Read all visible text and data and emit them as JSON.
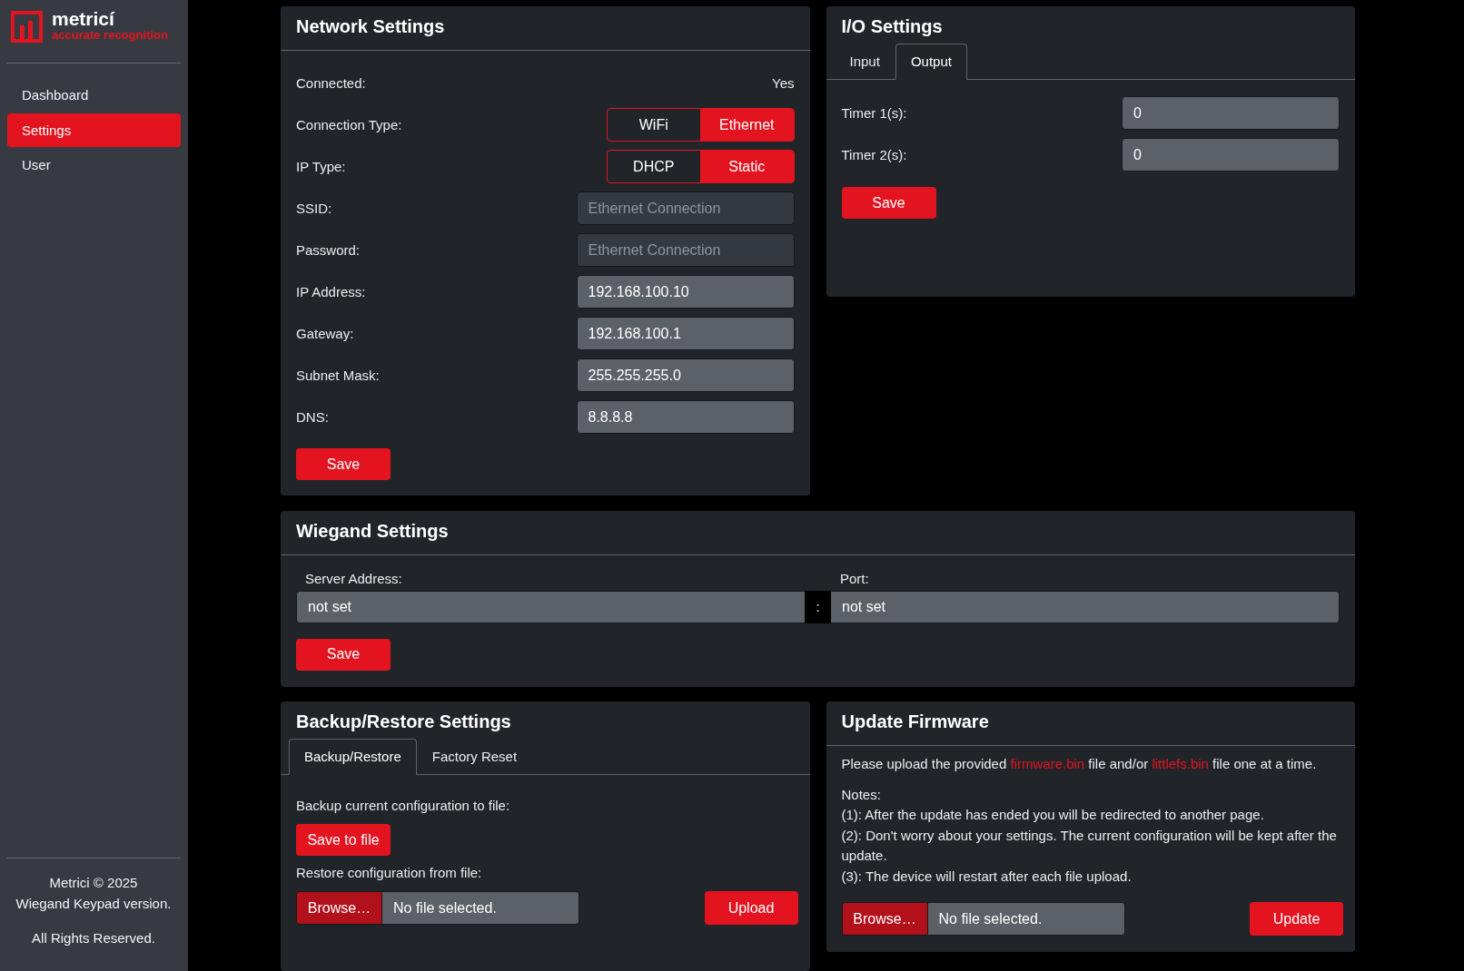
{
  "sidebar": {
    "logo": {
      "wordmark": "metricí",
      "tagline": "accurate recognition"
    },
    "nav": [
      {
        "label": "Dashboard",
        "selected": false
      },
      {
        "label": "Settings",
        "selected": true
      },
      {
        "label": "User",
        "selected": false
      }
    ],
    "footer": {
      "lines": [
        "Metrici © 2025",
        "Wiegand Keypad version."
      ],
      "rights": "All Rights Reserved."
    }
  },
  "network_settings": {
    "title": "Network Settings",
    "fields": [
      {
        "kind": "value",
        "label": "Connected:",
        "value": "Yes"
      },
      {
        "kind": "toggle",
        "label": "Connection Type:",
        "options": [
          {
            "label": "WiFi",
            "selected": false
          },
          {
            "label": "Ethernet",
            "selected": true
          }
        ]
      },
      {
        "kind": "toggle",
        "label": "IP Type:",
        "options": [
          {
            "label": "DHCP",
            "selected": false
          },
          {
            "label": "Static",
            "selected": true
          }
        ]
      },
      {
        "kind": "input",
        "label": "SSID:",
        "placeholder": "Ethernet Connection",
        "disabled": true
      },
      {
        "kind": "input",
        "label": "Password:",
        "placeholder": "Ethernet Connection",
        "disabled": true
      },
      {
        "kind": "input",
        "label": "IP Address:",
        "value": "192.168.100.10",
        "disabled": false
      },
      {
        "kind": "input",
        "label": "Gateway:",
        "value": "192.168.100.1",
        "disabled": false
      },
      {
        "kind": "input",
        "label": "Subnet Mask:",
        "value": "255.255.255.0",
        "disabled": false
      },
      {
        "kind": "input",
        "label": "DNS:",
        "value": "8.8.8.8",
        "disabled": false
      }
    ],
    "save_button": "Save"
  },
  "io_settings": {
    "title": "I/O Settings",
    "tabs": [
      {
        "label": "Input",
        "selected": false
      },
      {
        "label": "Output",
        "selected": true
      }
    ],
    "fields": [
      {
        "label": "Timer 1(s):",
        "value": "0"
      },
      {
        "label": "Timer 2(s):",
        "value": "0"
      }
    ],
    "save_button": "Save"
  },
  "wiegand_settings": {
    "title": "Wiegand Settings",
    "server_address": {
      "label": "Server Address:",
      "value": "not set"
    },
    "separator": ":",
    "port": {
      "label": "Port:",
      "value": "not set"
    },
    "save_button": "Save"
  },
  "backup_restore": {
    "title": "Backup/Restore Settings",
    "tabs": [
      {
        "label": "Backup/Restore",
        "selected": true
      },
      {
        "label": "Factory Reset",
        "selected": false
      }
    ],
    "backup_label": "Backup current configuration to file:",
    "save_to_file_button": "Save to file",
    "restore_label": "Restore configuration from file:",
    "file_input": {
      "button": "Browse…",
      "status": "No file selected."
    },
    "upload_button": "Upload"
  },
  "update_firmware": {
    "title": "Update Firmware",
    "instructions": [
      {
        "kind": "text",
        "text": "Please upload the provided "
      },
      {
        "kind": "link",
        "text": "firmware.bin"
      },
      {
        "kind": "text",
        "text": " file and/or "
      },
      {
        "kind": "link",
        "text": "littlefs.bin"
      },
      {
        "kind": "text",
        "text": " file one at a time."
      }
    ],
    "notes": {
      "heading": "Notes:",
      "items": [
        "(1): After the update has ended you will be redirected to another page.",
        "(2): Don't worry about your settings. The current configuration will be kept after the update.",
        "(3): The device will restart after each file upload."
      ]
    },
    "file_input": {
      "button": "Browse…",
      "status": "No file selected."
    },
    "update_button": "Update"
  }
}
